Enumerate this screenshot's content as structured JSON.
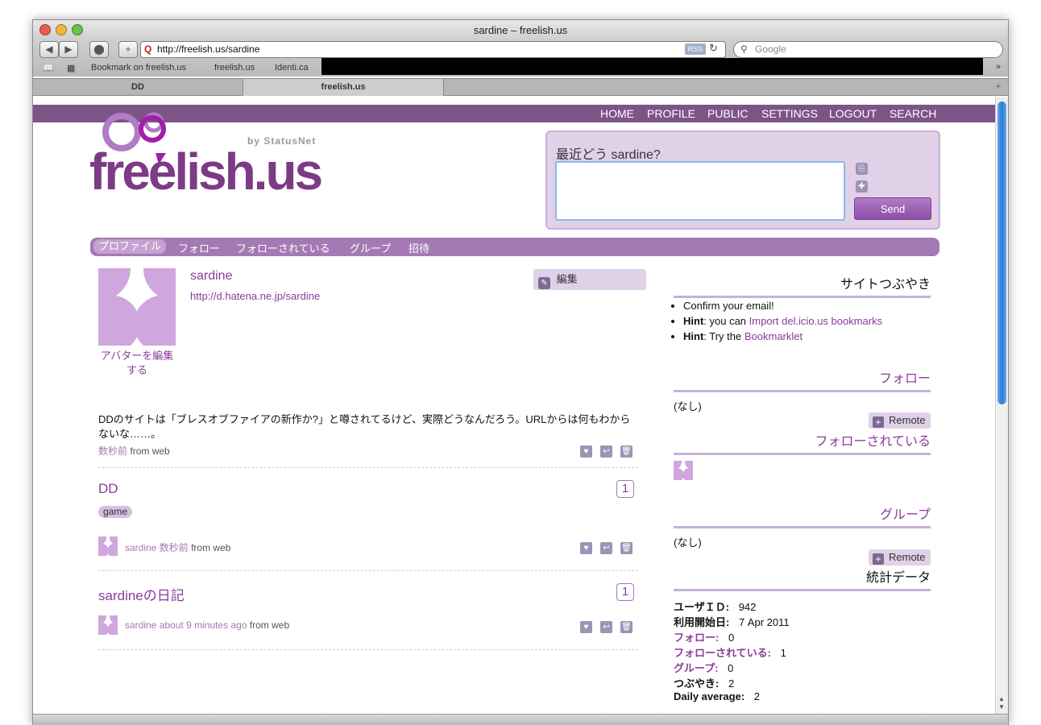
{
  "browser": {
    "window_title": "sardine – freelish.us",
    "url": "http://freelish.us/sardine",
    "rss_label": "RSS",
    "search_placeholder": "Google",
    "bookmarks": [
      "Bookmark on freelish.us",
      "freelish.us",
      "Identi.ca"
    ],
    "tabs": [
      {
        "label": "DD",
        "active": false
      },
      {
        "label": "freelish.us",
        "active": true
      }
    ]
  },
  "site": {
    "logo_text": "freelish.us",
    "logo_sub": "by StatusNet",
    "nav": [
      "HOME",
      "PROFILE",
      "PUBLIC",
      "SETTINGS",
      "LOGOUT",
      "SEARCH"
    ],
    "notice_prompt": "最近どう sardine?",
    "send_label": "Send",
    "profile_tabs": [
      "プロファイル",
      "フォロー",
      "フォローされている",
      "グループ",
      "招待"
    ]
  },
  "profile": {
    "nickname": "sardine",
    "homepage": "http://d.hatena.ne.jp/sardine",
    "edit_avatar": "アバターを編集する",
    "edit_label": "編集"
  },
  "notices": [
    {
      "text": "DDのサイトは「ブレスオブファイアの新作か?」と噂されてるけど、実際どうなんだろう。URLからは何もわからないな……。",
      "time": "数秒前",
      "source": "from web"
    }
  ],
  "items": [
    {
      "title": "DD",
      "count": "1",
      "tag": "game",
      "author": "sardine",
      "time": "数秒前",
      "source": "from web"
    },
    {
      "title": "sardineの日記",
      "count": "1",
      "author": "sardine",
      "time": "about 9 minutes ago",
      "source": "from web"
    }
  ],
  "sidebar": {
    "site_notice_title": "サイトつぶやき",
    "hints": {
      "confirm": "Confirm your email!",
      "hint_label": "Hint",
      "hint1_text": ": you can ",
      "hint1_link": "Import del.icio.us bookmarks",
      "hint2_text": ": Try the ",
      "hint2_link": "Bookmarklet"
    },
    "follow_title": "フォロー",
    "follow_none": "(なし)",
    "remote_label": "Remote",
    "followers_title": "フォローされている",
    "groups_title": "グループ",
    "groups_none": "(なし)",
    "stats_title": "統計データ",
    "stats": [
      {
        "label": "ユーザＩＤ:",
        "value": "942",
        "link": false
      },
      {
        "label": "利用開始日:",
        "value": "7 Apr 2011",
        "link": false
      },
      {
        "label": "フォロー:",
        "value": "0",
        "link": true
      },
      {
        "label": "フォローされている:",
        "value": "1",
        "link": true
      },
      {
        "label": "グループ:",
        "value": "0",
        "link": true
      },
      {
        "label": "つぶやき:",
        "value": "2",
        "link": false
      },
      {
        "label": "Daily average:",
        "value": "2",
        "link": false
      }
    ]
  }
}
